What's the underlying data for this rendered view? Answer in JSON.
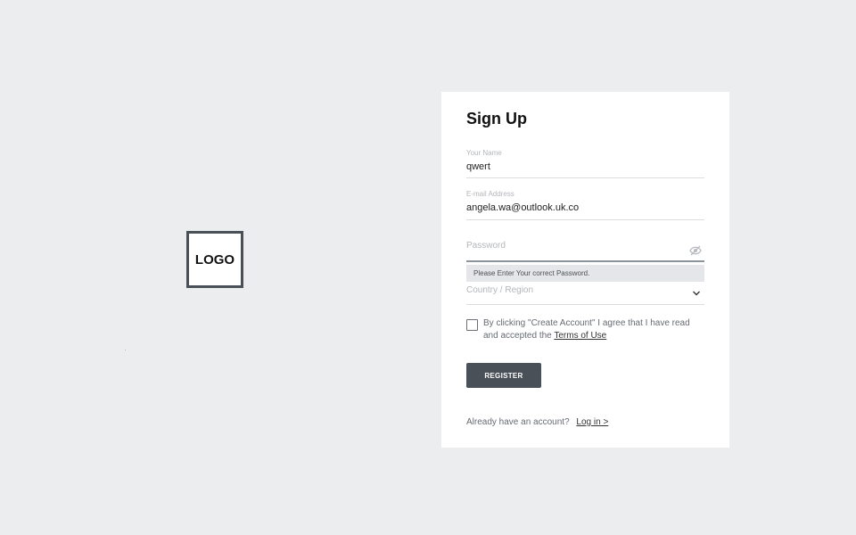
{
  "logo": {
    "text": "LOGO"
  },
  "form": {
    "title": "Sign Up",
    "name": {
      "label": "Your Name",
      "value": "qwert"
    },
    "email": {
      "label": "E-mail Address",
      "value": "angela.wa@outlook.uk.co"
    },
    "password": {
      "placeholder": "Password",
      "icon": "eye-slash-icon",
      "error": "Please Enter Your correct Password."
    },
    "country": {
      "placeholder": "Country / Region",
      "icon": "chevron-down-icon"
    },
    "terms": {
      "text": "By clicking \"Create Account\" I agree that I have read and accepted the",
      "link": "Terms of Use"
    },
    "register_label": "REGISTER",
    "login": {
      "text": "Already have an account?",
      "link": "Log in >"
    }
  },
  "colors": {
    "background": "#ecedef",
    "button": "#4a5058",
    "error_bg": "#e4e6e9"
  }
}
